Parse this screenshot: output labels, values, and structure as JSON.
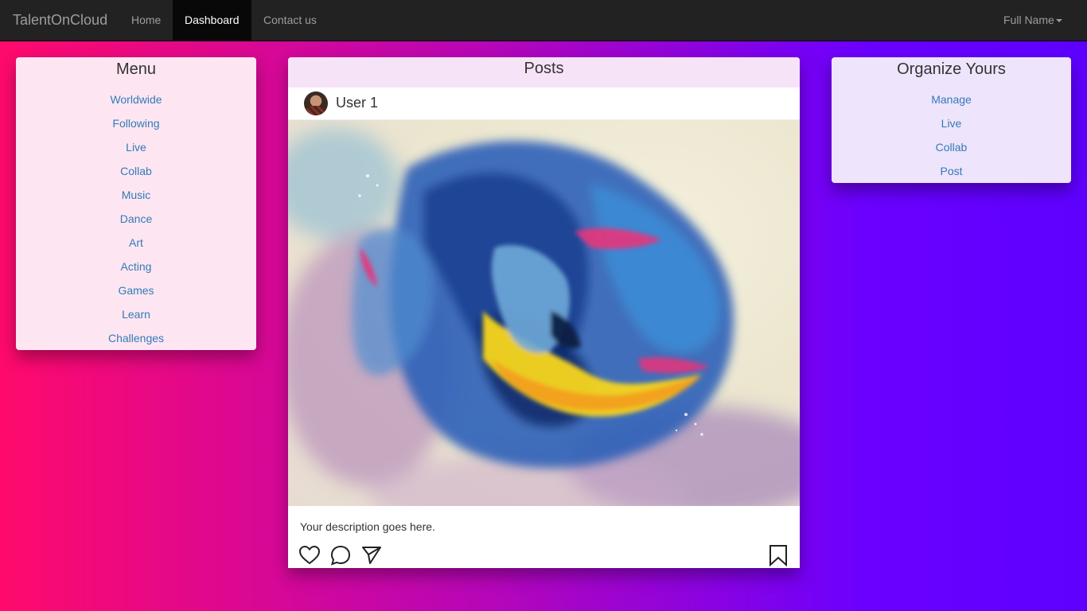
{
  "navbar": {
    "brand": "TalentOnCloud",
    "links": [
      {
        "label": "Home",
        "active": false
      },
      {
        "label": "Dashboard",
        "active": true
      },
      {
        "label": "Contact us",
        "active": false
      }
    ],
    "user_menu": "Full Name"
  },
  "menu": {
    "title": "Menu",
    "items": [
      "Worldwide",
      "Following",
      "Live",
      "Collab",
      "Music",
      "Dance",
      "Art",
      "Acting",
      "Games",
      "Learn",
      "Challenges"
    ]
  },
  "posts": {
    "title": "Posts",
    "post": {
      "username": "User 1",
      "description": "Your description goes here.",
      "icons": [
        "heart-icon",
        "comment-icon",
        "send-icon",
        "bookmark-icon"
      ]
    }
  },
  "organize": {
    "title": "Organize Yours",
    "items": [
      "Manage",
      "Live",
      "Collab",
      "Post"
    ]
  },
  "colors": {
    "navbar_bg": "#222222",
    "link": "#337ab7",
    "gradient_left": "#ff0a6c",
    "gradient_right": "#5e00ff"
  }
}
